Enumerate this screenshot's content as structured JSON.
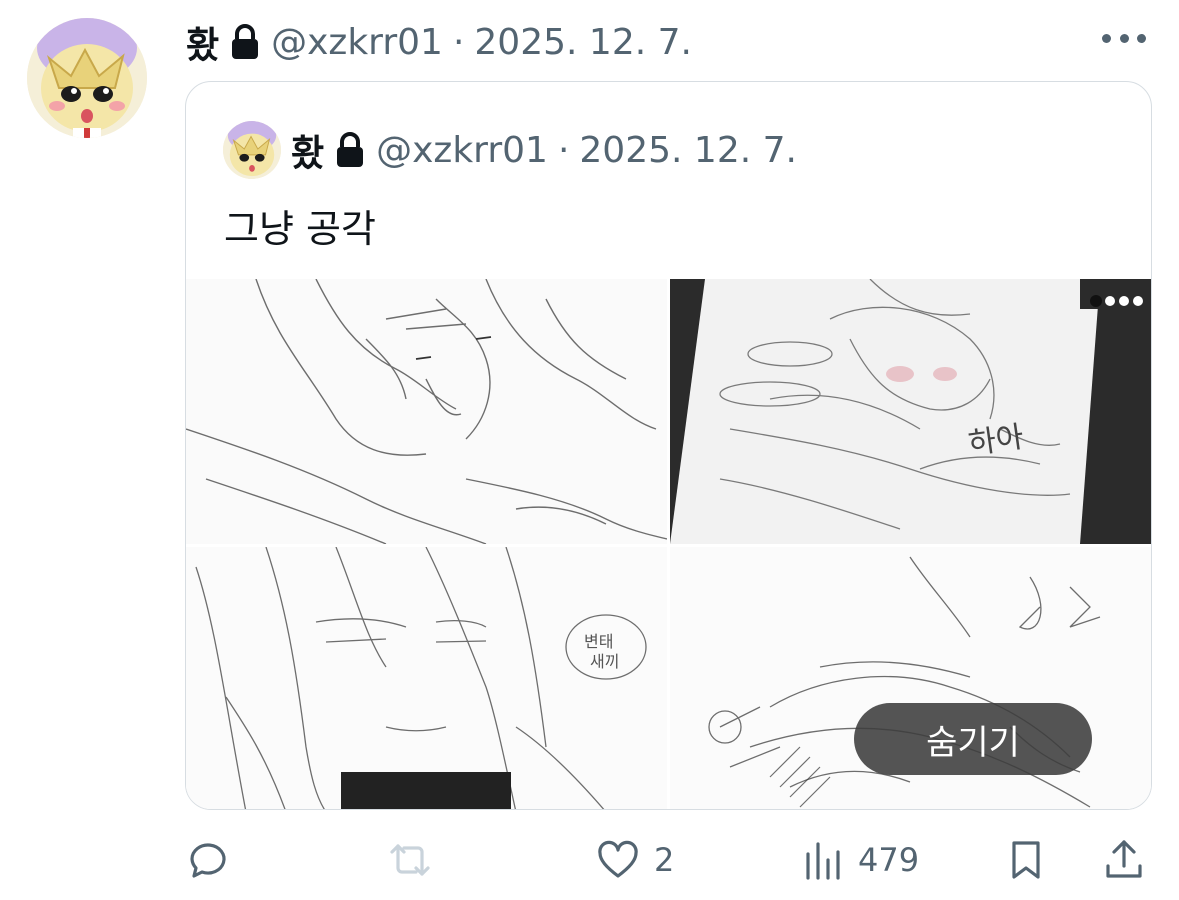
{
  "tweet": {
    "author_name": "홨",
    "handle": "@xzkrr01",
    "separator": "·",
    "date": "2025. 12. 7.",
    "more_icon": "more-horizontal-icon"
  },
  "quote": {
    "author_name": "홨",
    "handle": "@xzkrr01",
    "separator": "·",
    "date": "2025. 12. 7.",
    "text": "그냥 공각",
    "hide_label": "숨기기"
  },
  "actions": {
    "reply_icon": "reply-icon",
    "retweet_icon": "retweet-icon",
    "like_icon": "heart-icon",
    "like_count": "2",
    "views_icon": "views-chart-icon",
    "view_count": "479",
    "bookmark_icon": "bookmark-icon",
    "share_icon": "share-icon"
  },
  "colors": {
    "text_primary": "#0f1419",
    "text_secondary": "#536471",
    "border": "#d7dde2",
    "retweet_disabled": "#c9d3db",
    "hide_button_bg": "#3c3c3c"
  }
}
